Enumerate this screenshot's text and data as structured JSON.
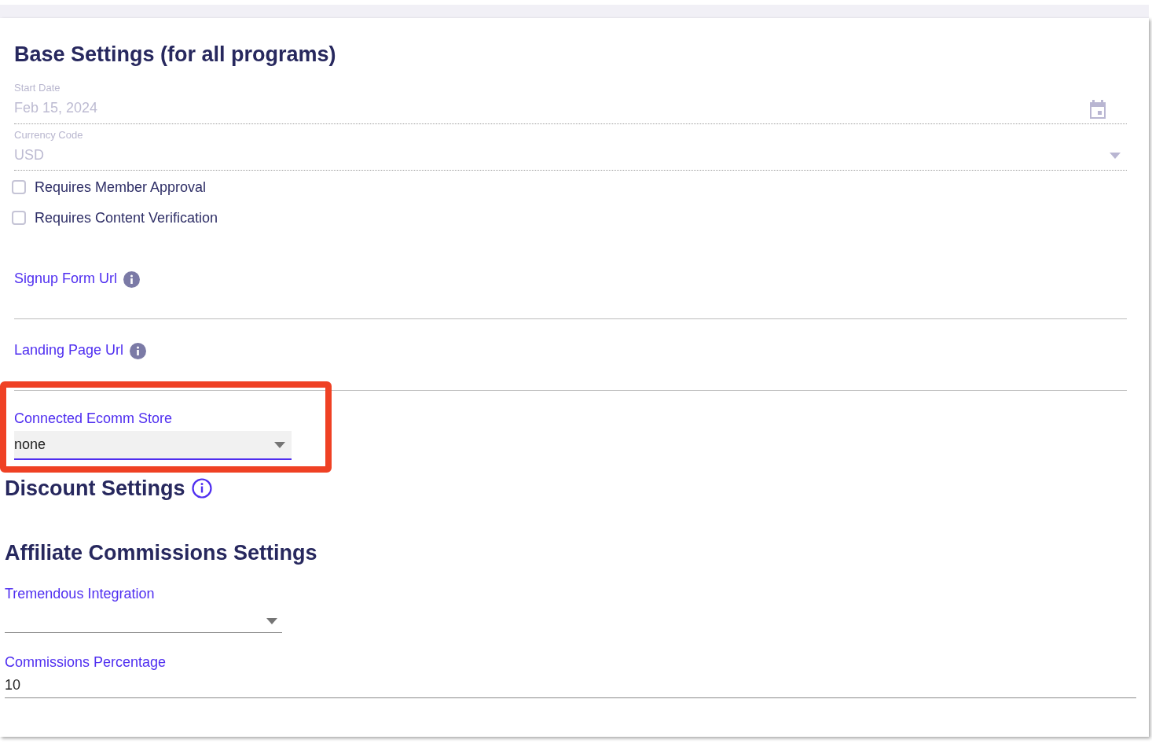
{
  "base_settings": {
    "title": "Base Settings (for all programs)",
    "fields": [
      {
        "kind": "date",
        "label": "Start Date",
        "value": "Feb 15, 2024",
        "disabled": true
      },
      {
        "kind": "select",
        "label": "Currency Code",
        "value": "USD",
        "disabled": true
      }
    ],
    "checkboxes": [
      {
        "label": "Requires Member Approval",
        "checked": false
      },
      {
        "label": "Requires Content Verification",
        "checked": false
      }
    ],
    "url_fields": [
      {
        "label": "Signup Form Url"
      },
      {
        "label": "Landing Page Url"
      }
    ],
    "ecomm_store": {
      "label": "Connected Ecomm Store",
      "value": "none",
      "highlighted": true
    }
  },
  "discount_settings": {
    "title": "Discount Settings"
  },
  "affiliate_commissions": {
    "title": "Affiliate Commissions Settings",
    "fields": [
      {
        "kind": "select",
        "label": "Tremendous Integration"
      },
      {
        "kind": "text",
        "label": "Commissions Percentage",
        "value": "10"
      }
    ]
  }
}
